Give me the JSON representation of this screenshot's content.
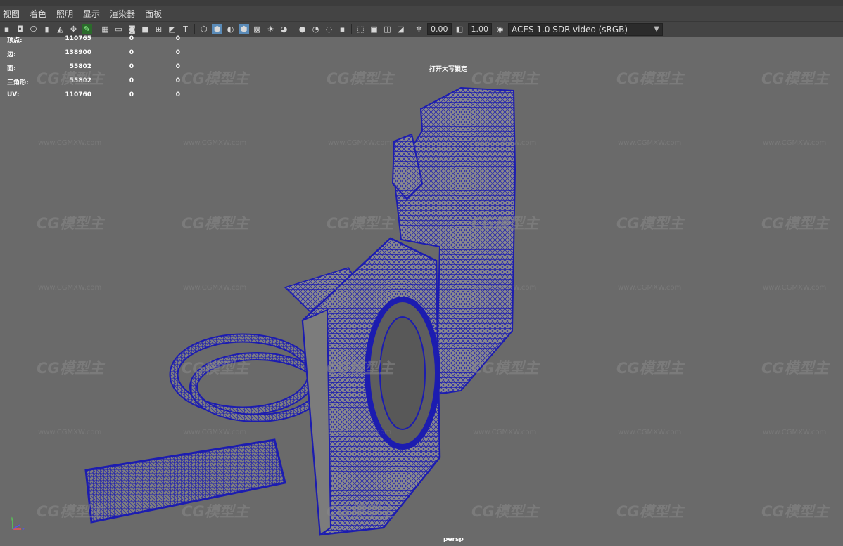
{
  "menu": [
    "视图",
    "着色",
    "照明",
    "显示",
    "渲染器",
    "面板"
  ],
  "toolbar": {
    "exposure": "0.00",
    "gamma": "1.00",
    "color_space": "ACES 1.0 SDR-video (sRGB)"
  },
  "stats": [
    {
      "label": "顶点:",
      "v1": "110765",
      "v2": "0",
      "v3": "0"
    },
    {
      "label": "边:",
      "v1": "138900",
      "v2": "0",
      "v3": "0"
    },
    {
      "label": "面:",
      "v1": "55802",
      "v2": "0",
      "v3": "0"
    },
    {
      "label": "三角形:",
      "v1": "55802",
      "v2": "0",
      "v3": "0"
    },
    {
      "label": "UV:",
      "v1": "110760",
      "v2": "0",
      "v3": "0"
    }
  ],
  "caps_lock": "打开大写锁定",
  "camera": "persp",
  "watermark": {
    "logo": "CG模型主",
    "url": "www.CGMXW.com"
  },
  "axis": {
    "y": "y",
    "x": "x",
    "z": "z"
  },
  "colors": {
    "wire": "#1c1cb0",
    "mesh": "#8c8c8c",
    "viewport": "#6a6a6a"
  }
}
